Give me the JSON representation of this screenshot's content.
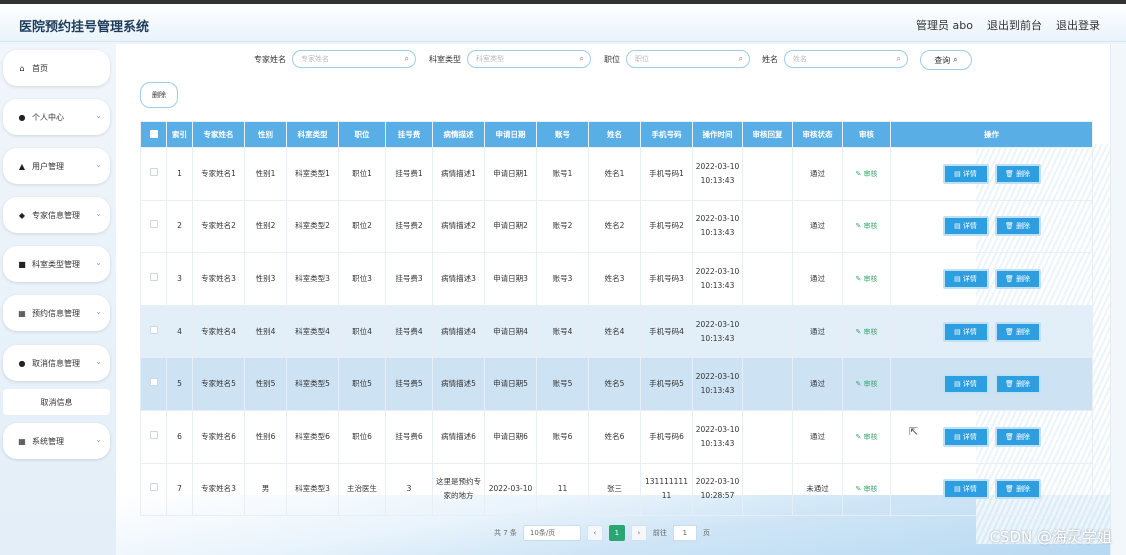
{
  "header": {
    "app_title": "医院预约挂号管理系统",
    "admin_label": "管理员 abo",
    "exit_front": "退出到前台",
    "logout": "退出登录"
  },
  "sidebar": {
    "items": [
      {
        "label": "首页",
        "icon": "home-icon",
        "glyph": "⌂"
      },
      {
        "label": "个人中心",
        "icon": "person-icon",
        "glyph": "●"
      },
      {
        "label": "用户管理",
        "icon": "users-icon",
        "glyph": "▲"
      },
      {
        "label": "专家信息管理",
        "icon": "send-icon",
        "glyph": "◆"
      },
      {
        "label": "科室类型管理",
        "icon": "card-icon",
        "glyph": "■"
      },
      {
        "label": "预约信息管理",
        "icon": "grid-icon",
        "glyph": "▦"
      },
      {
        "label": "取消信息管理",
        "icon": "location-icon",
        "glyph": "●"
      },
      {
        "label": "系统管理",
        "icon": "apps-icon",
        "glyph": "▦"
      }
    ],
    "submenu_label": "取消信息"
  },
  "search": {
    "expert_label": "专家姓名",
    "expert_placeholder": "专家姓名",
    "dept_label": "科室类型",
    "dept_placeholder": "科室类型",
    "position_label": "职位",
    "position_placeholder": "职位",
    "name_label": "姓名",
    "name_placeholder": "姓名",
    "query_button": "查询"
  },
  "toolbar": {
    "delete_label": "删除"
  },
  "table": {
    "headers": [
      "索引",
      "专家姓名",
      "性别",
      "科室类型",
      "职位",
      "挂号费",
      "病情描述",
      "申请日期",
      "账号",
      "姓名",
      "手机号码",
      "操作时间",
      "审核回复",
      "审核状态",
      "审核",
      "操作"
    ],
    "audit_label": "审核",
    "detail_label": "详情",
    "delete_label": "删除",
    "rows": [
      {
        "idx": "1",
        "expert": "专家姓名1",
        "gender": "性别1",
        "dept": "科室类型1",
        "pos": "职位1",
        "fee": "挂号费1",
        "desc": "病情描述1",
        "date": "申请日期1",
        "account": "账号1",
        "name": "姓名1",
        "phone": "手机号码1",
        "optime": "2022-03-10 10:13:43",
        "reply": "",
        "status": "通过"
      },
      {
        "idx": "2",
        "expert": "专家姓名2",
        "gender": "性别2",
        "dept": "科室类型2",
        "pos": "职位2",
        "fee": "挂号费2",
        "desc": "病情描述2",
        "date": "申请日期2",
        "account": "账号2",
        "name": "姓名2",
        "phone": "手机号码2",
        "optime": "2022-03-10 10:13:43",
        "reply": "",
        "status": "通过"
      },
      {
        "idx": "3",
        "expert": "专家姓名3",
        "gender": "性别3",
        "dept": "科室类型3",
        "pos": "职位3",
        "fee": "挂号费3",
        "desc": "病情描述3",
        "date": "申请日期3",
        "account": "账号3",
        "name": "姓名3",
        "phone": "手机号码3",
        "optime": "2022-03-10 10:13:43",
        "reply": "",
        "status": "通过"
      },
      {
        "idx": "4",
        "expert": "专家姓名4",
        "gender": "性别4",
        "dept": "科室类型4",
        "pos": "职位4",
        "fee": "挂号费4",
        "desc": "病情描述4",
        "date": "申请日期4",
        "account": "账号4",
        "name": "姓名4",
        "phone": "手机号码4",
        "optime": "2022-03-10 10:13:43",
        "reply": "",
        "status": "通过"
      },
      {
        "idx": "5",
        "expert": "专家姓名5",
        "gender": "性别5",
        "dept": "科室类型5",
        "pos": "职位5",
        "fee": "挂号费5",
        "desc": "病情描述5",
        "date": "申请日期5",
        "account": "账号5",
        "name": "姓名5",
        "phone": "手机号码5",
        "optime": "2022-03-10 10:13:43",
        "reply": "",
        "status": "通过"
      },
      {
        "idx": "6",
        "expert": "专家姓名6",
        "gender": "性别6",
        "dept": "科室类型6",
        "pos": "职位6",
        "fee": "挂号费6",
        "desc": "病情描述6",
        "date": "申请日期6",
        "account": "账号6",
        "name": "姓名6",
        "phone": "手机号码6",
        "optime": "2022-03-10 10:13:43",
        "reply": "",
        "status": "通过"
      },
      {
        "idx": "7",
        "expert": "专家姓名3",
        "gender": "男",
        "dept": "科室类型3",
        "pos": "主治医生",
        "fee": "3",
        "desc": "这里是预约专家的地方",
        "date": "2022-03-10",
        "account": "11",
        "name": "张三",
        "phone": "13111111111",
        "optime": "2022-03-10 10:28:57",
        "reply": "",
        "status": "未通过"
      }
    ]
  },
  "pagination": {
    "total": "共 7 条",
    "page_size": "10条/页",
    "current": "1",
    "goto_label": "前往",
    "goto_value": "1",
    "page_suffix": "页"
  },
  "watermark": "CSDN @海灵学姐",
  "colors": {
    "header_bg": "#5aaee6",
    "button": "#2d9ee0",
    "audit": "#3aa56b",
    "active_page": "#2aa672"
  }
}
